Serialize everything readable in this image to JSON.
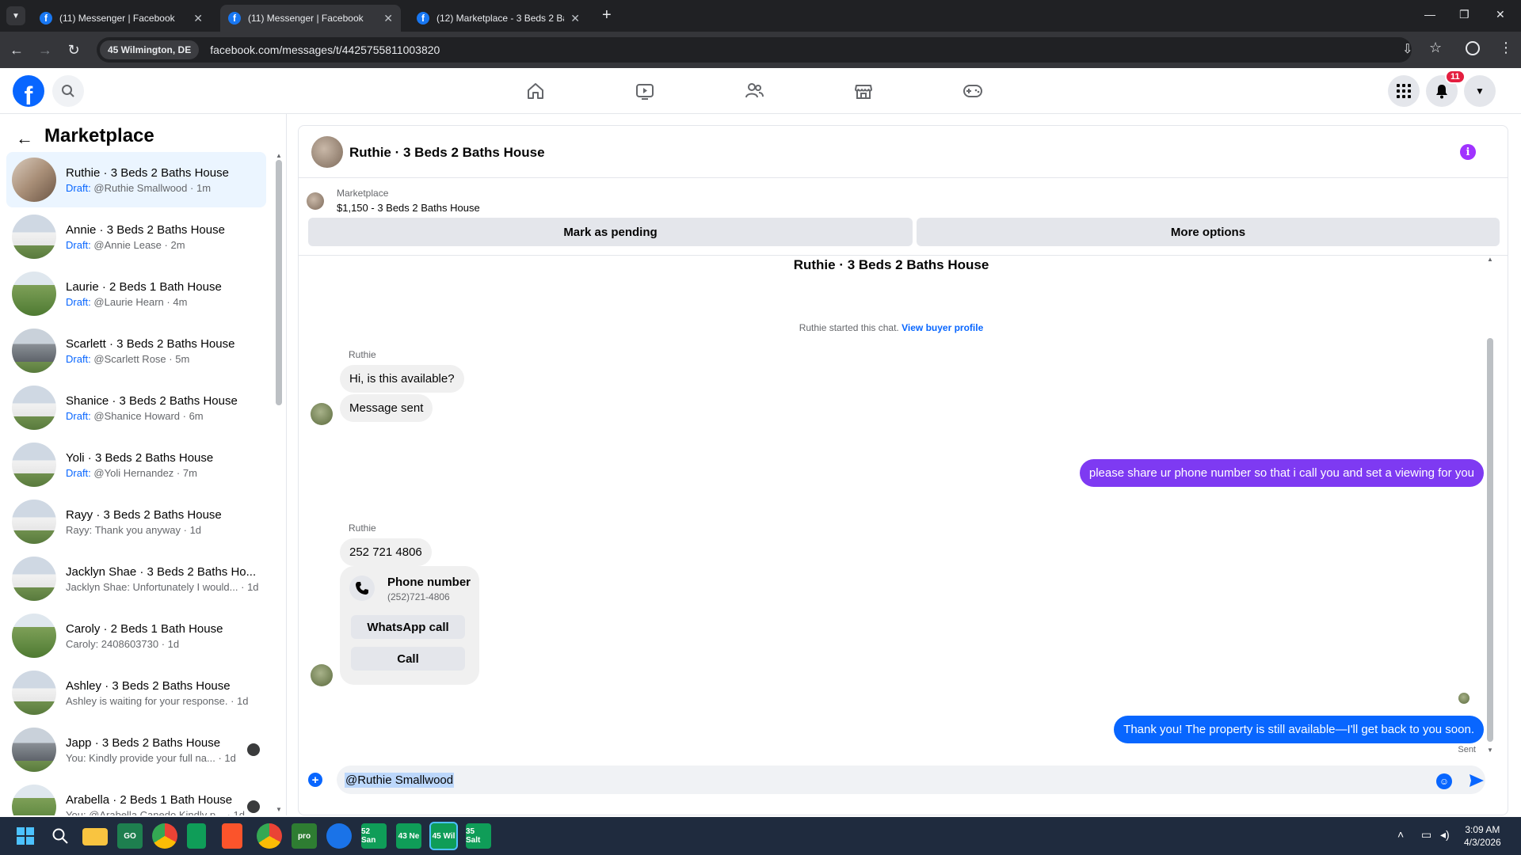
{
  "browser": {
    "tabs": [
      {
        "title": "(11) Messenger | Facebook",
        "active": false
      },
      {
        "title": "(11) Messenger | Facebook",
        "active": true
      },
      {
        "title": "(12) Marketplace - 3 Beds 2 Bat",
        "active": false
      }
    ],
    "location_chip": "45 Wilmington, DE",
    "url": "facebook.com/messages/t/4425755811003820"
  },
  "header": {
    "notification_count": "11"
  },
  "sidebar": {
    "title": "Marketplace",
    "conversations": [
      {
        "name": "Ruthie · 3 Beds 2 Baths House",
        "draft_label": "Draft:",
        "preview": "@Ruthie Smallwood",
        "time": "1m",
        "selected": true,
        "thumb": "interior"
      },
      {
        "name": "Annie · 3 Beds 2 Baths House",
        "draft_label": "Draft:",
        "preview": "@Annie Lease",
        "time": "2m",
        "thumb": "house"
      },
      {
        "name": "Laurie · 2 Beds 1 Bath House",
        "draft_label": "Draft:",
        "preview": "@Laurie Hearn",
        "time": "4m",
        "thumb": "field"
      },
      {
        "name": "Scarlett · 3 Beds 2 Baths House",
        "draft_label": "Draft:",
        "preview": "@Scarlett Rose",
        "time": "5m",
        "thumb": "garage"
      },
      {
        "name": "Shanice · 3 Beds 2 Baths House",
        "draft_label": "Draft:",
        "preview": "@Shanice Howard",
        "time": "6m",
        "thumb": "house"
      },
      {
        "name": "Yoli · 3 Beds 2 Baths House",
        "draft_label": "Draft:",
        "preview": "@Yoli Hernandez",
        "time": "7m",
        "thumb": "house"
      },
      {
        "name": "Rayy · 3 Beds 2 Baths House",
        "draft_label": "",
        "preview": "Rayy: Thank you anyway",
        "time": "1d",
        "thumb": "house"
      },
      {
        "name": "Jacklyn Shae · 3 Beds 2 Baths Ho...",
        "draft_label": "",
        "preview": "Jacklyn Shae: Unfortunately I would...",
        "time": "1d",
        "thumb": "house"
      },
      {
        "name": "Caroly · 2 Beds 1 Bath House",
        "draft_label": "",
        "preview": "Caroly: 2408603730",
        "time": "1d",
        "thumb": "field"
      },
      {
        "name": "Ashley · 3 Beds 2 Baths House",
        "draft_label": "",
        "preview": "Ashley is waiting for your response.",
        "time": "1d",
        "thumb": "house"
      },
      {
        "name": "Japp · 3 Beds 2 Baths House",
        "draft_label": "",
        "preview": "You: Kindly provide your full na...",
        "time": "1d",
        "thumb": "garage",
        "mini": true
      },
      {
        "name": "Arabella · 2 Beds 1 Bath House",
        "draft_label": "",
        "preview": "You: @Arabella Canedo Kindly p...",
        "time": "1d",
        "thumb": "field",
        "mini": true
      }
    ]
  },
  "chat": {
    "title": "Ruthie · 3 Beds 2 Baths House",
    "marketplace_label": "Marketplace",
    "listing": "$1,150 - 3 Beds 2 Baths House",
    "mark_pending": "Mark as pending",
    "more_options": "More options",
    "conversation_title": "Ruthie · 3 Beds 2 Baths House",
    "started_text": "Ruthie started this chat.",
    "view_buyer_profile": "View buyer profile",
    "messages": {
      "sender1": "Ruthie",
      "m1": "Hi, is this available?",
      "m2": "Message sent",
      "m3": "please share ur phone number so that i call you and set a viewing for you",
      "sender2": "Ruthie",
      "m4": "252 721 4806",
      "phone_title": "Phone number",
      "phone_value": "(252)721-4806",
      "whatsapp_call": "WhatsApp call",
      "call": "Call",
      "m5": "Thank you! The property is still available—I'll get back to you soon.",
      "status": "Sent"
    },
    "composer_text": "@Ruthie Smallwood"
  },
  "taskbar": {
    "time": "3:09 AM",
    "date": "4/3/2026",
    "badges": [
      "52 San",
      "43 Ne",
      "45 Wil",
      "35 Salt"
    ]
  },
  "colors": {
    "brand": "#0866ff",
    "outgoing_purple": "#7e3af2",
    "selected_row": "#ebf5ff"
  }
}
